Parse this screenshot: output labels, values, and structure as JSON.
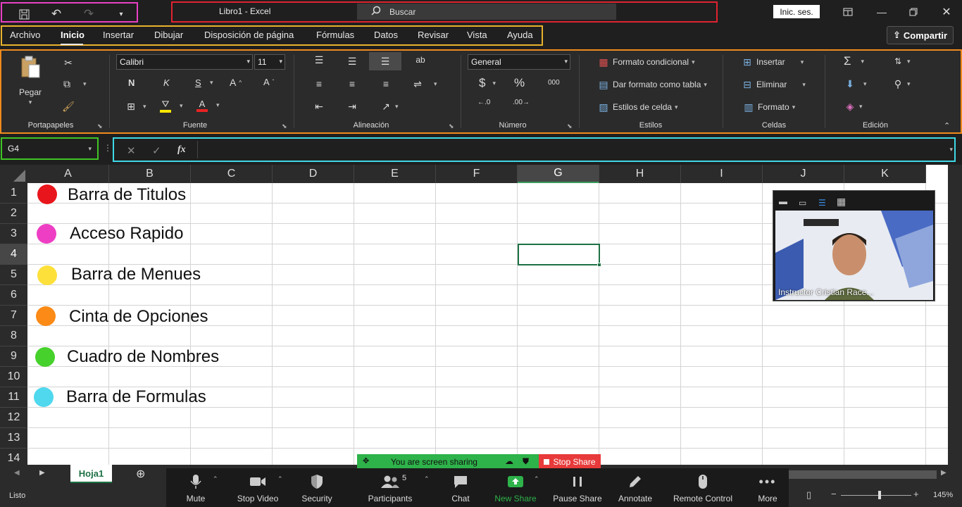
{
  "title_bar": {
    "doc_title": "Libro1  -  Excel",
    "search_placeholder": "Buscar",
    "signin_label": "Inic. ses."
  },
  "menu": {
    "items": [
      "Archivo",
      "Inicio",
      "Insertar",
      "Dibujar",
      "Disposición de página",
      "Fórmulas",
      "Datos",
      "Revisar",
      "Vista",
      "Ayuda"
    ],
    "active": "Inicio",
    "share_label": "Compartir"
  },
  "ribbon": {
    "portapapeles": {
      "paste_label": "Pegar",
      "group_label": "Portapapeles"
    },
    "fuente": {
      "font_name": "Calibri",
      "font_size": "11",
      "bold": "N",
      "italic": "K",
      "underline": "S",
      "group_label": "Fuente"
    },
    "alineacion": {
      "group_label": "Alineación"
    },
    "numero": {
      "format": "General",
      "currency": "$",
      "percent": "%",
      "thousands": "000",
      "group_label": "Número"
    },
    "estilos": {
      "conditional": "Formato condicional",
      "as_table": "Dar formato como tabla",
      "cell_styles": "Estilos de celda",
      "group_label": "Estilos"
    },
    "celdas": {
      "insert": "Insertar",
      "delete": "Eliminar",
      "format": "Formato",
      "group_label": "Celdas"
    },
    "edicion": {
      "group_label": "Edición"
    }
  },
  "formula_bar": {
    "name_box": "G4",
    "fx": "fx",
    "cancel": "✕",
    "enter": "✓"
  },
  "grid": {
    "columns": [
      "A",
      "B",
      "C",
      "D",
      "E",
      "F",
      "G",
      "H",
      "I",
      "J",
      "K"
    ],
    "rows": [
      "1",
      "2",
      "3",
      "4",
      "5",
      "6",
      "7",
      "8",
      "9",
      "10",
      "11",
      "12",
      "13",
      "14"
    ],
    "selected_column": "G",
    "selected_row": "4"
  },
  "legend": [
    {
      "label": "Barra de Titulos",
      "color": "#e8161c"
    },
    {
      "label": "Acceso Rapido",
      "color": "#ee3fc4"
    },
    {
      "label": "Barra de Menues",
      "color": "#fde03a"
    },
    {
      "label": "Cinta de Opciones",
      "color": "#fb8a16"
    },
    {
      "label": "Cuadro de Nombres",
      "color": "#47d12c"
    },
    {
      "label": "Barra de Formulas",
      "color": "#4fd8ee"
    }
  ],
  "video": {
    "name": "Instructor Cristian Race..."
  },
  "sheet": {
    "tab": "Hoja1",
    "status": "Listo",
    "zoom": "145%"
  },
  "zoom_toolbar": {
    "sharing_text": "You are screen sharing",
    "stop_share": "Stop Share",
    "buttons": [
      "Mute",
      "Stop Video",
      "Security",
      "Participants",
      "Chat",
      "New Share",
      "Pause Share",
      "Annotate",
      "Remote Control",
      "More"
    ],
    "participants_count": "5"
  },
  "colors": {
    "accent_green": "#1e7145",
    "zoom_green": "#2eb24a",
    "stop_red": "#e83a3a"
  }
}
